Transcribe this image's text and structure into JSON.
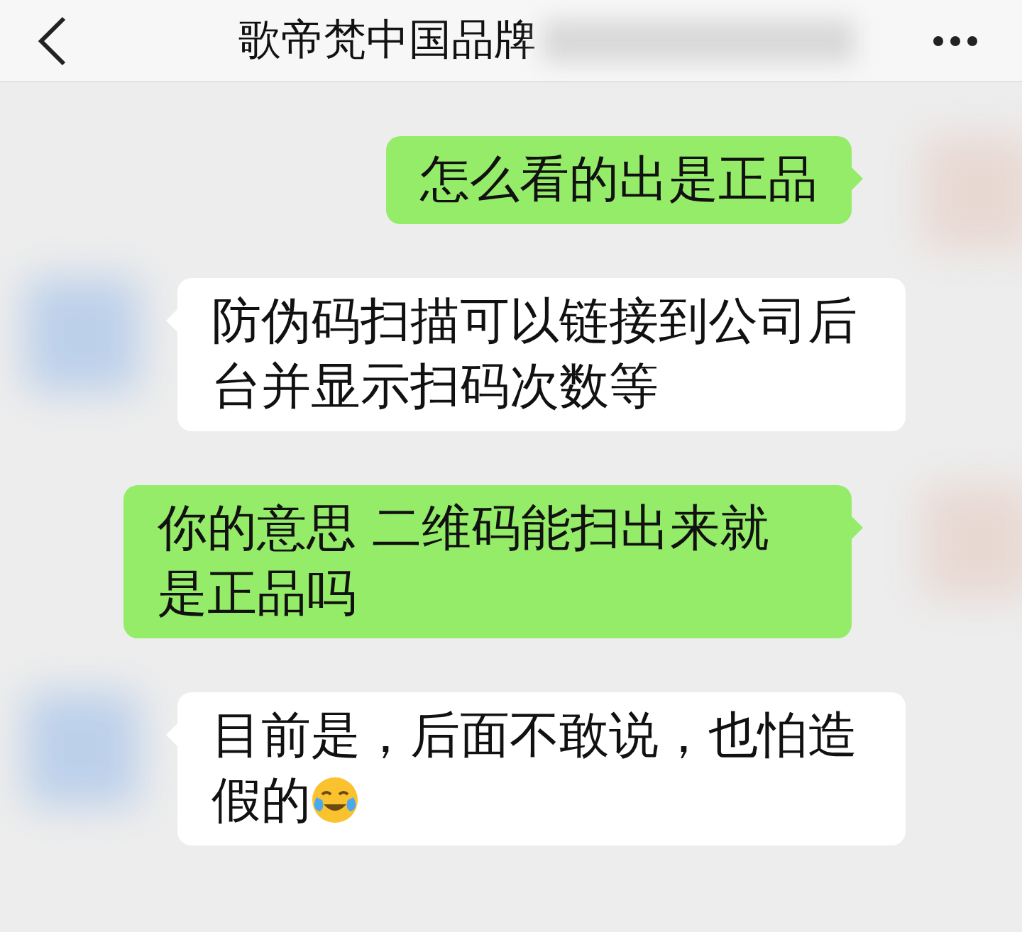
{
  "header": {
    "title": "歌帝梵中国品牌"
  },
  "messages": [
    {
      "kind": "sent",
      "text": "怎么看的出是正品",
      "emoji": false
    },
    {
      "kind": "received",
      "text": "防伪码扫描可以链接到公司后台并显示扫码次数等",
      "emoji": false
    },
    {
      "kind": "sent",
      "text": "你的意思 二维码能扫出来就是正品吗",
      "emoji": false
    },
    {
      "kind": "received",
      "text": "目前是，后面不敢说，也怕造假的",
      "emoji": true
    }
  ]
}
